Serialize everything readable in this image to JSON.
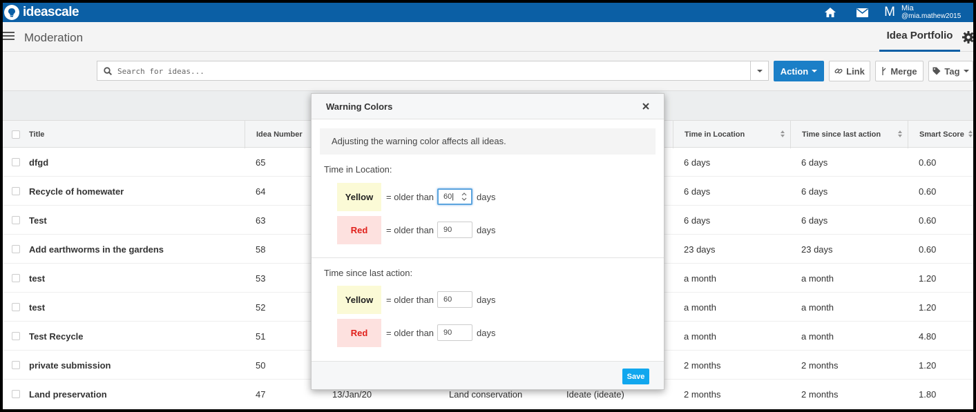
{
  "topbar": {
    "logo_text": "ideascale",
    "avatar_letter": "M",
    "user_name": "Mia",
    "user_handle": "@mia.mathew2015",
    "icons": [
      "home-icon",
      "mail-icon"
    ]
  },
  "header": {
    "title": "Moderation",
    "tab": "Idea Portfolio"
  },
  "search": {
    "placeholder": "Search for ideas..."
  },
  "toolbar": {
    "action_label": "Action",
    "link_label": "Link",
    "merge_label": "Merge",
    "tag_label": "Tag"
  },
  "table": {
    "columns": {
      "title": "Title",
      "idea_number": "Idea Number",
      "time_in_location": "Time in Location",
      "time_since_action": "Time since last action",
      "smart_score": "Smart Score"
    },
    "rows": [
      {
        "title": "dfgd",
        "number": "65",
        "date": "",
        "category": "",
        "stage": "",
        "location": "6 days",
        "last_action": "6 days",
        "score": "0.60"
      },
      {
        "title": "Recycle of homewater",
        "number": "64",
        "date": "",
        "category": "",
        "stage": "",
        "location": "6 days",
        "last_action": "6 days",
        "score": "0.60"
      },
      {
        "title": "Test",
        "number": "63",
        "date": "",
        "category": "",
        "stage": "",
        "location": "6 days",
        "last_action": "6 days",
        "score": "0.60"
      },
      {
        "title": "Add earthworms in the gardens",
        "number": "58",
        "date": "",
        "category": "",
        "stage": "",
        "location": "23 days",
        "last_action": "23 days",
        "score": "0.60"
      },
      {
        "title": "test",
        "number": "53",
        "date": "",
        "category": "",
        "stage": "",
        "location": "a month",
        "last_action": "a month",
        "score": "1.20"
      },
      {
        "title": "test",
        "number": "52",
        "date": "",
        "category": "",
        "stage": "",
        "location": "a month",
        "last_action": "a month",
        "score": "1.20"
      },
      {
        "title": "Test Recycle",
        "number": "51",
        "date": "",
        "category": "",
        "stage": "",
        "location": "a month",
        "last_action": "a month",
        "score": "4.80"
      },
      {
        "title": "private submission",
        "number": "50",
        "date": "",
        "category": "",
        "stage": "",
        "location": "2 months",
        "last_action": "2 months",
        "score": "1.20"
      },
      {
        "title": "Land preservation",
        "number": "47",
        "date": "13/Jan/20",
        "category": "Land conservation",
        "stage": "Ideate (ideate)",
        "location": "2 months",
        "last_action": "2 months",
        "score": "1.80"
      }
    ]
  },
  "modal": {
    "title": "Warning Colors",
    "note": "Adjusting the warning color affects all ideas.",
    "older_than": "= older than",
    "days": "days",
    "save_label": "Save",
    "sections": [
      {
        "label": "Time in Location:",
        "yellow_label": "Yellow",
        "yellow_value": "60",
        "red_label": "Red",
        "red_value": "90"
      },
      {
        "label": "Time since last action:",
        "yellow_label": "Yellow",
        "yellow_value": "60",
        "red_label": "Red",
        "red_value": "90"
      }
    ]
  },
  "colors": {
    "brand_blue": "#0b5fa5",
    "action_blue": "#1b7fc7",
    "save_blue": "#11a7ee",
    "warning_yellow_bg": "#fbfad6",
    "warning_red_bg": "#fde1df",
    "warning_red_text": "#e0201b"
  }
}
